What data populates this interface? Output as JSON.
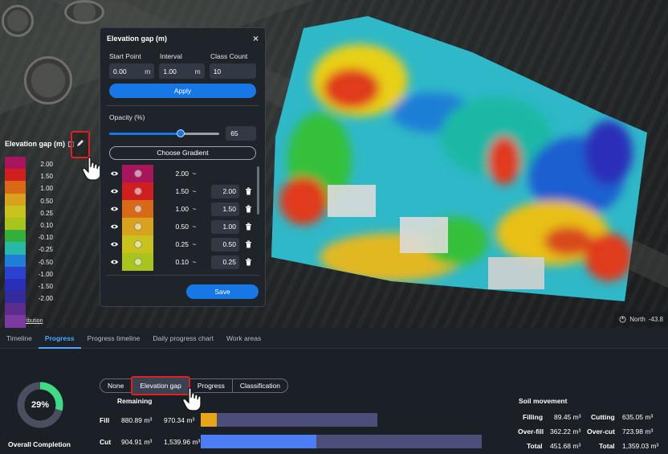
{
  "map": {
    "attribution": "Data attribution",
    "north_label": "North",
    "north_value": "-43.8"
  },
  "legend": {
    "title": "Elevation gap (m)",
    "colors": [
      "#a8155c",
      "#cf1f1f",
      "#d86a17",
      "#d8a21c",
      "#c8c21c",
      "#a9c41c",
      "#34b03a",
      "#27b8a6",
      "#1f7fd6",
      "#2a43cf",
      "#2a2fb8",
      "#332a9c",
      "#5c2c8f",
      "#7c3aa0",
      "#8d47ab"
    ],
    "labels": [
      "2.00",
      "1.50",
      "1.00",
      "0.50",
      "0.25",
      "0.10",
      "-0.10",
      "-0.25",
      "-0.50",
      "-1.00",
      "-1.50",
      "-2.00"
    ]
  },
  "panel": {
    "title": "Elevation gap (m)",
    "start_label": "Start Point",
    "interval_label": "Interval",
    "count_label": "Class Count",
    "start_value": "0.00",
    "start_unit": "m",
    "interval_value": "1.00",
    "interval_unit": "m",
    "count_value": "10",
    "apply_label": "Apply",
    "opacity_label": "Opacity (%)",
    "opacity_value": "65",
    "opacity_fraction": 0.65,
    "gradient_label": "Choose Gradient",
    "rows": [
      {
        "color": "#a8155c",
        "from": "2.00",
        "tilde": "~",
        "to": ""
      },
      {
        "color": "#cf1f1f",
        "from": "1.50",
        "tilde": "~",
        "to": "2.00"
      },
      {
        "color": "#d86a17",
        "from": "1.00",
        "tilde": "~",
        "to": "1.50"
      },
      {
        "color": "#d8a21c",
        "from": "0.50",
        "tilde": "~",
        "to": "1.00"
      },
      {
        "color": "#c8c21c",
        "from": "0.25",
        "tilde": "~",
        "to": "0.50"
      },
      {
        "color": "#a9c41c",
        "from": "0.10",
        "tilde": "~",
        "to": "0.25"
      }
    ],
    "save_label": "Save"
  },
  "tabs": [
    "Timeline",
    "Progress",
    "Progress timeline",
    "Daily progress chart",
    "Work areas"
  ],
  "active_tab": "Progress",
  "dashboard": {
    "completion_percent": "29%",
    "completion_fraction": 0.29,
    "overall_label": "Overall Completion",
    "segments": [
      "None",
      "Elevation gap",
      "Progress",
      "Classification"
    ],
    "active_segment": "Elevation gap",
    "remaining_label": "Remaining",
    "fill": {
      "label": "Fill",
      "remaining": "880.89 m³",
      "total": "970.34 m³",
      "fraction": 0.092,
      "color": "#e8a617"
    },
    "cut": {
      "label": "Cut",
      "remaining": "904.91 m³",
      "total": "1,539.96 m³",
      "fraction": 0.41,
      "color": "#4d7df5"
    },
    "soil": {
      "title": "Soil movement",
      "filling_label": "Filling",
      "filling_value": "89.45 m³",
      "cutting_label": "Cutting",
      "cutting_value": "635.05 m³",
      "overfill_label": "Over-fill",
      "overfill_value": "362.22 m³",
      "overcut_label": "Over-cut",
      "overcut_value": "723.98 m³",
      "total_fill_label": "Total",
      "total_fill_value": "451.68 m³",
      "total_cut_label": "Total",
      "total_cut_value": "1,359.03 m³"
    }
  }
}
